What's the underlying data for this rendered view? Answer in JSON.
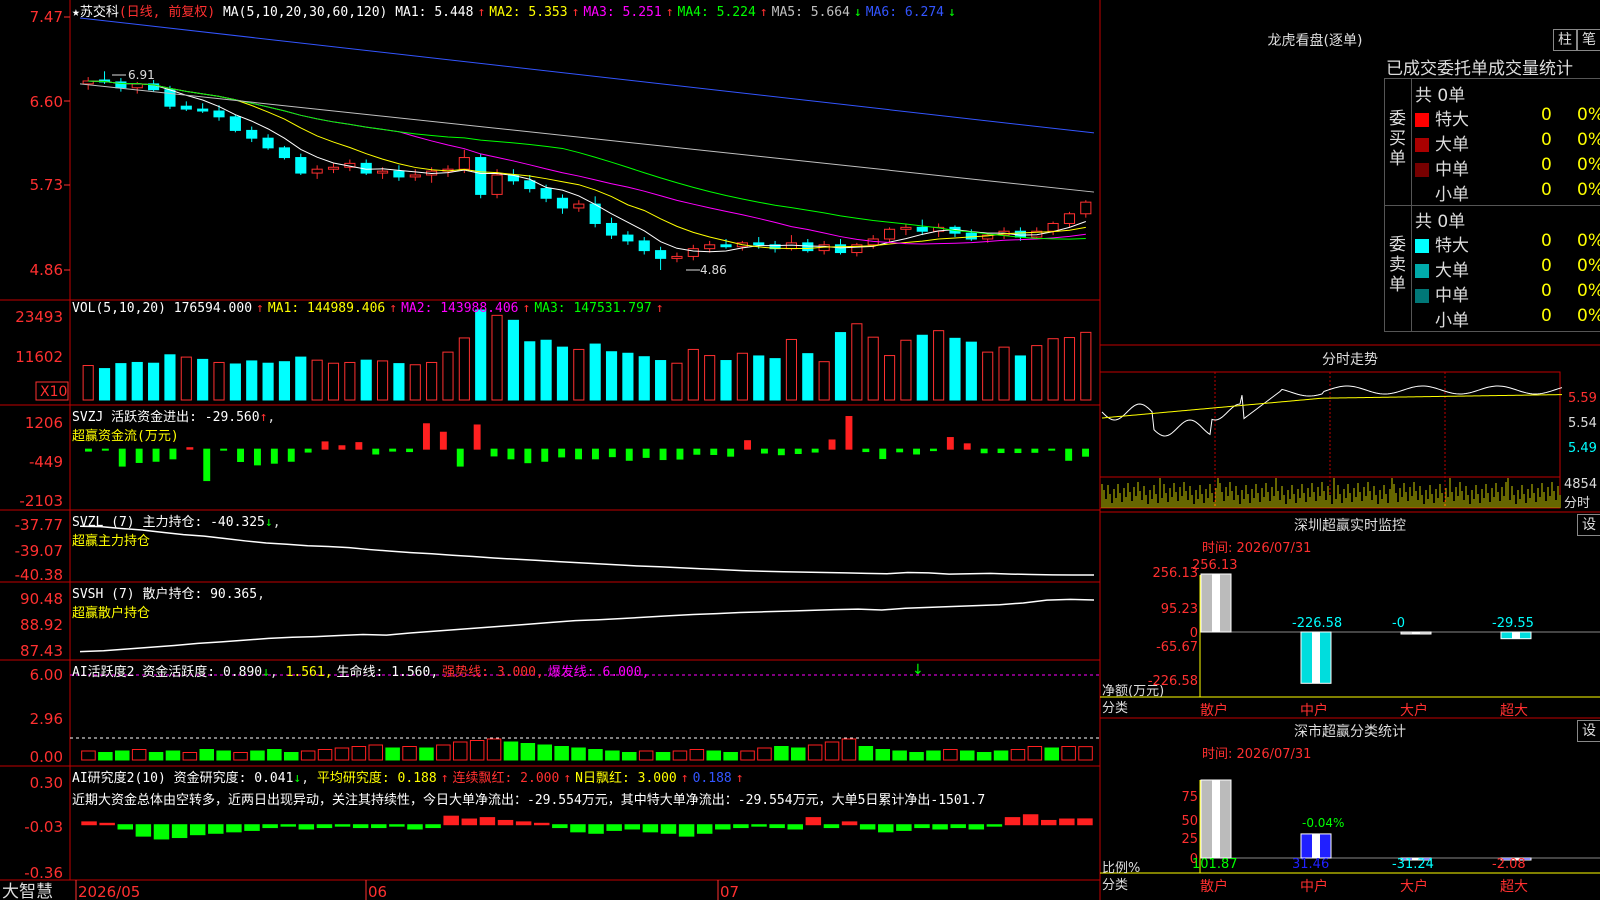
{
  "stock": {
    "name": "苏交科",
    "period": "(日线, 前复权)",
    "star": "★"
  },
  "main_header": {
    "ma_params": "MA(5,10,20,30,60,120)",
    "items": [
      {
        "label": "MA1: 5.448",
        "arrow": "↑",
        "color": "#ffffff"
      },
      {
        "label": "MA2: 5.353",
        "arrow": "↑",
        "color": "#ffff00"
      },
      {
        "label": "MA3: 5.251",
        "arrow": "↑",
        "color": "#ff00ff"
      },
      {
        "label": "MA4: 5.224",
        "arrow": "↑",
        "color": "#00ff00"
      },
      {
        "label": "MA5: 5.664",
        "arrow": "↓",
        "color": "#c0c0c0"
      },
      {
        "label": "MA6: 6.274",
        "arrow": "↓",
        "color": "#3355ff"
      }
    ]
  },
  "price_axis": [
    "7.47",
    "6.60",
    "5.73",
    "4.86"
  ],
  "price_marks": {
    "high": "6.91",
    "low": "4.86"
  },
  "volume_header": {
    "label": "VOL(5,10,20)",
    "items": [
      {
        "label": "176594.000",
        "arrow": "↑",
        "color": "#ffffff"
      },
      {
        "label": "MA1: 144989.406",
        "arrow": "↑",
        "color": "#ffff00"
      },
      {
        "label": "MA2: 143988.406",
        "arrow": "↑",
        "color": "#ff00ff"
      },
      {
        "label": "MA3: 147531.797",
        "arrow": "↑",
        "color": "#00ff00"
      }
    ]
  },
  "volume_axis": [
    "23493",
    "11602"
  ],
  "volume_unit": "X10",
  "svzj": {
    "title": "SVZJ  活跃资金进出: -29.560",
    "arrow": "↑",
    "sub": "超赢资金流(万元)",
    "axis": [
      "1206",
      "-449",
      "-2103"
    ]
  },
  "svzl": {
    "title": "SVZL (7) 主力持仓: -40.325",
    "arrow": "↓",
    "sub": "超赢主力持仓",
    "axis": [
      "-37.77",
      "-39.07",
      "-40.38"
    ]
  },
  "svsh": {
    "title": "SVSH (7) 散户持仓: 90.365",
    "arrow": "↑",
    "sub": "超赢散户持仓",
    "axis": [
      "90.48",
      "88.92",
      "87.43"
    ]
  },
  "ai_active": {
    "title": "AI活跃度2 资金活跃度: 0.890",
    "parts": [
      {
        "label": "1.561,",
        "color": "#ffff00"
      },
      {
        "label": "生命线: 1.560,",
        "color": "#ffffff"
      },
      {
        "label": "强势线: 3.000,",
        "color": "#ff3030"
      },
      {
        "label": "爆发线: 6.000,",
        "color": "#ff00ff"
      }
    ],
    "axis": [
      "6.00",
      "2.96",
      "0.00"
    ]
  },
  "ai_research": {
    "title": "AI研究度2(10) 资金研究度: 0.041",
    "parts": [
      {
        "label": "平均研究度: 0.188",
        "color": "#ffff00"
      },
      {
        "label": "连续飘红: 2.000",
        "color": "#ff3030"
      },
      {
        "label": "N日飘红: 3.000",
        "color": "#ffff00"
      },
      {
        "label": "0.188",
        "color": "#3355ff"
      }
    ],
    "note": "近期大资金总体由空转多，近两日出现异动，关注其持续性，今日大单净流出：-29.554万元，其中特大单净流出：-29.554万元，大单5日累计净出-1501.7",
    "axis": [
      "0.30",
      "-0.03",
      "-0.36"
    ]
  },
  "date_axis": {
    "labels": [
      "2026/05",
      "06",
      "07"
    ],
    "brand": "大智慧"
  },
  "dragon": {
    "title": "龙虎看盘(逐单)",
    "btn1": "柱",
    "btn2": "笔",
    "subtitle": "已成交委托单成交量统计",
    "buy": {
      "side": "委买单",
      "total": "共 0单",
      "rows": [
        {
          "name": "特大",
          "count": "0",
          "pct": "0%",
          "color": "#ff0000"
        },
        {
          "name": "大单",
          "count": "0",
          "pct": "0%",
          "color": "#aa0000"
        },
        {
          "name": "中单",
          "count": "0",
          "pct": "0%",
          "color": "#770000"
        },
        {
          "name": "小单",
          "count": "0",
          "pct": "0%",
          "color": "#000000"
        }
      ]
    },
    "sell": {
      "side": "委卖单",
      "total": "共 0单",
      "rows": [
        {
          "name": "特大",
          "count": "0",
          "pct": "0%",
          "color": "#00ffff"
        },
        {
          "name": "大单",
          "count": "0",
          "pct": "0%",
          "color": "#00aaaa"
        },
        {
          "name": "中单",
          "count": "0",
          "pct": "0%",
          "color": "#007777"
        },
        {
          "name": "小单",
          "count": "0",
          "pct": "0%",
          "color": "#000000"
        }
      ]
    }
  },
  "intraday": {
    "title": "分时走势",
    "axis": [
      "5.59",
      "5.54",
      "5.49"
    ],
    "vol_max": "4854",
    "vol_label": "分时"
  },
  "monitor": {
    "title": "深圳超赢实时监控",
    "btn": "设",
    "time": "时间: 2026/07/31",
    "axis": [
      "256.13",
      "95.23",
      "0",
      "-65.67",
      "-226.58"
    ],
    "ylabel": "净额(万元)",
    "xlabel": "分类",
    "categories": [
      "散户",
      "中户",
      "大户",
      "超大"
    ],
    "values": [
      256.13,
      -226.58,
      0,
      -29.55
    ],
    "value_labels": [
      "256.13",
      "-226.58",
      "-0",
      "-29.55"
    ]
  },
  "classify": {
    "title": "深市超赢分类统计",
    "btn": "设",
    "time": "时间: 2026/07/31",
    "axis": [
      "75",
      "50",
      "25",
      "0"
    ],
    "ylabel": "比例%",
    "xlabel": "分类",
    "categories": [
      "散户",
      "中户",
      "大户",
      "超大"
    ],
    "values": [
      101.87,
      31.46,
      -31.24,
      -2.08
    ],
    "value_labels": [
      "101.87",
      "31.46",
      "-31.24",
      "-2.08"
    ],
    "annotation": "-0.04%"
  },
  "chart_data": [
    {
      "type": "candlestick",
      "title": "苏交科 (日线, 前复权)",
      "x": [
        "2026/05",
        "06",
        "07"
      ],
      "ylim": [
        4.86,
        7.47
      ],
      "ohlc": [
        [
          6.78,
          6.85,
          6.72,
          6.81
        ],
        [
          6.82,
          6.91,
          6.78,
          6.8
        ],
        [
          6.8,
          6.84,
          6.7,
          6.74
        ],
        [
          6.74,
          6.8,
          6.68,
          6.78
        ],
        [
          6.78,
          6.82,
          6.7,
          6.72
        ],
        [
          6.72,
          6.76,
          6.52,
          6.55
        ],
        [
          6.55,
          6.6,
          6.5,
          6.52
        ],
        [
          6.52,
          6.58,
          6.48,
          6.5
        ],
        [
          6.5,
          6.56,
          6.4,
          6.44
        ],
        [
          6.44,
          6.46,
          6.28,
          6.3
        ],
        [
          6.3,
          6.34,
          6.18,
          6.22
        ],
        [
          6.22,
          6.26,
          6.1,
          6.12
        ],
        [
          6.12,
          6.14,
          6.0,
          6.02
        ],
        [
          6.02,
          6.06,
          5.84,
          5.86
        ],
        [
          5.86,
          5.94,
          5.8,
          5.9
        ],
        [
          5.9,
          5.96,
          5.86,
          5.92
        ],
        [
          5.92,
          6.0,
          5.88,
          5.96
        ],
        [
          5.96,
          6.0,
          5.84,
          5.86
        ],
        [
          5.86,
          5.92,
          5.8,
          5.88
        ],
        [
          5.88,
          5.94,
          5.78,
          5.82
        ],
        [
          5.82,
          5.9,
          5.78,
          5.84
        ],
        [
          5.84,
          5.92,
          5.76,
          5.88
        ],
        [
          5.88,
          5.94,
          5.82,
          5.9
        ],
        [
          5.9,
          6.1,
          5.86,
          6.02
        ],
        [
          6.02,
          6.06,
          5.6,
          5.64
        ],
        [
          5.64,
          5.9,
          5.6,
          5.84
        ],
        [
          5.84,
          5.9,
          5.74,
          5.78
        ],
        [
          5.78,
          5.84,
          5.66,
          5.7
        ],
        [
          5.7,
          5.74,
          5.56,
          5.6
        ],
        [
          5.6,
          5.64,
          5.44,
          5.5
        ],
        [
          5.5,
          5.58,
          5.46,
          5.54
        ],
        [
          5.54,
          5.62,
          5.3,
          5.34
        ],
        [
          5.34,
          5.4,
          5.18,
          5.22
        ],
        [
          5.22,
          5.26,
          5.12,
          5.16
        ],
        [
          5.16,
          5.2,
          5.02,
          5.06
        ],
        [
          5.06,
          5.1,
          4.86,
          4.98
        ],
        [
          4.98,
          5.04,
          4.94,
          5.0
        ],
        [
          5.0,
          5.12,
          4.96,
          5.08
        ],
        [
          5.08,
          5.16,
          5.04,
          5.12
        ],
        [
          5.12,
          5.18,
          5.08,
          5.1
        ],
        [
          5.1,
          5.16,
          5.06,
          5.14
        ],
        [
          5.14,
          5.2,
          5.08,
          5.12
        ],
        [
          5.12,
          5.16,
          5.04,
          5.08
        ],
        [
          5.08,
          5.22,
          5.06,
          5.14
        ],
        [
          5.14,
          5.18,
          5.04,
          5.06
        ],
        [
          5.06,
          5.16,
          5.02,
          5.12
        ],
        [
          5.12,
          5.18,
          5.02,
          5.04
        ],
        [
          5.04,
          5.14,
          5.0,
          5.12
        ],
        [
          5.12,
          5.22,
          5.08,
          5.18
        ],
        [
          5.18,
          5.3,
          5.14,
          5.28
        ],
        [
          5.28,
          5.34,
          5.22,
          5.3
        ],
        [
          5.3,
          5.38,
          5.22,
          5.26
        ],
        [
          5.26,
          5.34,
          5.2,
          5.3
        ],
        [
          5.3,
          5.32,
          5.2,
          5.24
        ],
        [
          5.24,
          5.28,
          5.16,
          5.18
        ],
        [
          5.18,
          5.24,
          5.14,
          5.22
        ],
        [
          5.22,
          5.3,
          5.18,
          5.26
        ],
        [
          5.26,
          5.3,
          5.16,
          5.2
        ],
        [
          5.2,
          5.3,
          5.18,
          5.26
        ],
        [
          5.26,
          5.36,
          5.22,
          5.34
        ],
        [
          5.34,
          5.46,
          5.3,
          5.44
        ],
        [
          5.44,
          5.58,
          5.4,
          5.56
        ]
      ]
    },
    {
      "type": "bar",
      "title": "VOL(5,10,20)",
      "ylim": [
        0,
        23493
      ],
      "values": [
        9000,
        8200,
        9500,
        9800,
        9600,
        11800,
        11200,
        10600,
        9800,
        9400,
        10200,
        9600,
        10000,
        11200,
        10400,
        9600,
        9800,
        10400,
        10200,
        9500,
        9200,
        9800,
        12500,
        16200,
        23493,
        22100,
        20800,
        15200,
        15600,
        13800,
        13200,
        14600,
        12600,
        12200,
        11300,
        10300,
        9600,
        13200,
        11600,
        10300,
        12200,
        11500,
        10800,
        15800,
        12100,
        10000,
        17600,
        19900,
        16400,
        11600,
        15600,
        16900,
        18100,
        16100,
        15100,
        12500,
        13800,
        11500,
        14200,
        16000,
        16300,
        17659
      ],
      "up": [
        1,
        0,
        0,
        0,
        0,
        0,
        1,
        0,
        1,
        0,
        0,
        0,
        0,
        0,
        1,
        1,
        1,
        0,
        1,
        0,
        1,
        1,
        1,
        1,
        0,
        1,
        0,
        0,
        0,
        0,
        1,
        0,
        0,
        0,
        0,
        0,
        1,
        1,
        1,
        0,
        1,
        0,
        0,
        1,
        0,
        1,
        0,
        1,
        1,
        1,
        1,
        0,
        1,
        0,
        0,
        1,
        1,
        0,
        1,
        1,
        1,
        1
      ]
    },
    {
      "type": "bar",
      "title": "SVZJ 活跃资金进出",
      "ylim": [
        -2103,
        1206
      ],
      "values": [
        -80,
        -20,
        -700,
        -550,
        -500,
        -400,
        60,
        -1300,
        -40,
        -510,
        -650,
        -580,
        -500,
        -120,
        300,
        140,
        270,
        -200,
        -80,
        -100,
        1050,
        700,
        -700,
        1000,
        -280,
        -400,
        -560,
        -500,
        -320,
        -400,
        -400,
        -310,
        -460,
        -340,
        -430,
        -410,
        -210,
        -220,
        -290,
        350,
        -160,
        -230,
        -180,
        -120,
        380,
        1350,
        -100,
        -390,
        -110,
        -200,
        -60,
        480,
        220,
        -150,
        -140,
        -140,
        -130,
        -40,
        -460,
        -290
      ],
      "unit": "万元"
    },
    {
      "type": "line",
      "title": "SVZL (7) 主力持仓",
      "ylim": [
        -40.38,
        -37.77
      ],
      "values": [
        -37.78,
        -37.8,
        -37.9,
        -37.98,
        -38.1,
        -38.22,
        -38.3,
        -38.42,
        -38.55,
        -38.66,
        -38.72,
        -38.8,
        -38.84,
        -38.9,
        -39.0,
        -39.08,
        -39.16,
        -39.22,
        -39.3,
        -39.36,
        -39.44,
        -39.5,
        -39.56,
        -39.62,
        -39.68,
        -39.74,
        -39.8,
        -39.86,
        -39.9,
        -39.95,
        -40.0,
        -40.05,
        -40.1,
        -40.13,
        -40.16,
        -40.18,
        -40.2,
        -40.22,
        -40.24,
        -40.26,
        -40.2,
        -40.22,
        -40.28,
        -40.26,
        -40.24,
        -40.28,
        -40.3,
        -40.32,
        -40.33,
        -40.33
      ]
    },
    {
      "type": "line",
      "title": "SVSH (7) 散户持仓",
      "ylim": [
        87.43,
        90.48
      ],
      "values": [
        87.45,
        87.5,
        87.6,
        87.7,
        87.8,
        87.92,
        88.0,
        88.1,
        88.2,
        88.26,
        88.3,
        88.36,
        88.42,
        88.38,
        88.5,
        88.6,
        88.7,
        88.8,
        88.9,
        89.0,
        89.1,
        89.2,
        89.25,
        89.32,
        89.4,
        89.48,
        89.55,
        89.6,
        89.66,
        89.7,
        89.74,
        89.78,
        89.82,
        89.85,
        89.8,
        89.9,
        89.95,
        90.0,
        90.05,
        90.1,
        90.2,
        90.36,
        90.4,
        90.37
      ]
    },
    {
      "type": "bar",
      "title": "AI活跃度2 资金活跃度",
      "ylim": [
        0,
        6.0
      ],
      "values": [
        0.6,
        0.5,
        0.6,
        0.7,
        0.5,
        0.6,
        0.5,
        0.7,
        0.6,
        0.5,
        0.6,
        0.7,
        0.5,
        0.6,
        0.7,
        0.8,
        0.9,
        1.0,
        0.8,
        0.9,
        0.8,
        1.0,
        1.2,
        1.3,
        1.4,
        1.2,
        1.1,
        1.0,
        0.9,
        0.8,
        0.7,
        0.6,
        0.5,
        0.6,
        0.5,
        0.6,
        0.7,
        0.6,
        0.5,
        0.6,
        0.8,
        0.9,
        0.8,
        1.0,
        1.2,
        1.4,
        0.9,
        0.7,
        0.6,
        0.5,
        0.6,
        0.7,
        0.6,
        0.5,
        0.6,
        0.7,
        0.9,
        0.8,
        0.9,
        0.89
      ],
      "up": [
        1,
        0,
        0,
        1,
        0,
        0,
        1,
        0,
        0,
        1,
        0,
        0,
        0,
        1,
        1,
        1,
        1,
        1,
        0,
        1,
        0,
        1,
        1,
        1,
        1,
        0,
        0,
        0,
        0,
        0,
        0,
        0,
        0,
        1,
        0,
        1,
        1,
        0,
        0,
        1,
        1,
        0,
        0,
        1,
        1,
        1,
        0,
        0,
        0,
        0,
        0,
        1,
        0,
        0,
        0,
        1,
        1,
        0,
        1,
        1
      ]
    },
    {
      "type": "bar",
      "title": "AI研究度2(10) 资金研究度",
      "ylim": [
        -0.36,
        0.3
      ],
      "values": [
        0.02,
        0.01,
        -0.03,
        -0.08,
        -0.1,
        -0.09,
        -0.07,
        -0.06,
        -0.05,
        -0.04,
        -0.02,
        -0.01,
        -0.03,
        -0.02,
        -0.01,
        -0.02,
        -0.02,
        -0.01,
        -0.03,
        -0.02,
        0.06,
        0.04,
        0.05,
        0.03,
        0.02,
        0.01,
        -0.02,
        -0.05,
        -0.06,
        -0.04,
        -0.03,
        -0.05,
        -0.06,
        -0.08,
        -0.06,
        -0.03,
        -0.02,
        -0.01,
        -0.02,
        -0.03,
        0.05,
        -0.02,
        0.02,
        -0.03,
        -0.05,
        -0.04,
        -0.02,
        -0.03,
        -0.02,
        -0.03,
        -0.01,
        0.05,
        0.07,
        0.03,
        0.04,
        0.041
      ]
    },
    {
      "type": "bar",
      "title": "深圳超赢实时监控",
      "categories": [
        "散户",
        "中户",
        "大户",
        "超大"
      ],
      "values": [
        256.13,
        -226.58,
        0,
        -29.55
      ],
      "ylim": [
        -226.58,
        256.13
      ],
      "ylabel": "净额(万元)"
    },
    {
      "type": "bar",
      "title": "深市超赢分类统计",
      "categories": [
        "散户",
        "中户",
        "大户",
        "超大"
      ],
      "values": [
        101.87,
        31.46,
        -31.24,
        -2.08
      ],
      "ylim": [
        0,
        75
      ],
      "ylabel": "比例%"
    }
  ]
}
